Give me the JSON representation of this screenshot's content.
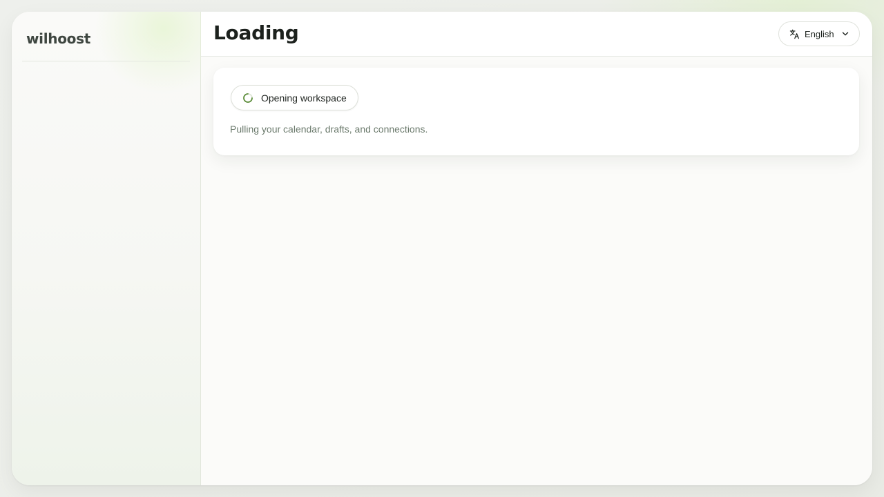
{
  "brand": {
    "logo_text": "wilhoost"
  },
  "header": {
    "title": "Loading"
  },
  "language": {
    "label": "English",
    "icon": "translate-icon",
    "chevron": "chevron-down-icon"
  },
  "loading_card": {
    "status_label": "Opening workspace",
    "spinner_icon": "spinner-icon",
    "description": "Pulling your calendar, drafts, and connections."
  },
  "colors": {
    "accent": "#5f8f3e",
    "title_text": "#1c211d",
    "muted_text": "#6b7a6c"
  }
}
